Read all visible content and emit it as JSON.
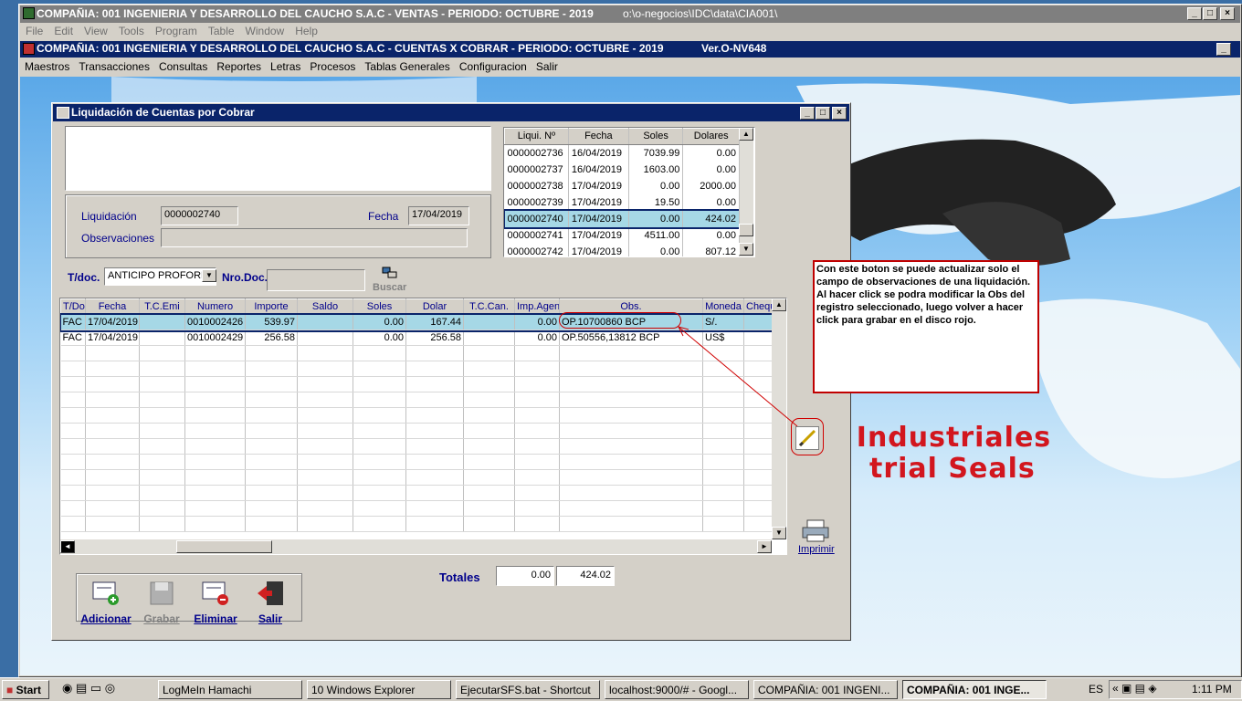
{
  "outer_window": {
    "title": "COMPAÑIA:  001 INGENIERIA Y DESARROLLO DEL CAUCHO S.A.C   -   VENTAS   -   PERIODO: OCTUBRE - 2019",
    "path": "o:\\o-negocios\\IDC\\data\\CIA001\\",
    "menu": [
      "File",
      "Edit",
      "View",
      "Tools",
      "Program",
      "Table",
      "Window",
      "Help"
    ]
  },
  "inner_window": {
    "title": "COMPAÑIA:  001 INGENIERIA Y DESARROLLO DEL CAUCHO S.A.C   -   CUENTAS X COBRAR   -   PERIODO: OCTUBRE - 2019",
    "version": "Ver.O-NV648",
    "menu": [
      "Maestros",
      "Transacciones",
      "Consultas",
      "Reportes",
      "Letras",
      "Procesos",
      "Tablas Generales",
      "Configuracion",
      "Salir"
    ]
  },
  "background_banner": {
    "line1": "e Industriales",
    "line2": "trial Seals"
  },
  "dialog": {
    "title": "Liquidación de Cuentas por Cobrar",
    "liquidacion_label": "Liquidación",
    "liquidacion_value": "0000002740",
    "fecha_label": "Fecha",
    "fecha_value": "17/04/2019",
    "observaciones_label": "Observaciones",
    "observaciones_value": "",
    "tdoc_label": "T/doc.",
    "tdoc_value": "ANTICIPO PROFORMA",
    "nrodoc_label": "Nro.Doc.",
    "nrodoc_value": "",
    "buscar_label": "Buscar",
    "liq_headers": [
      "Liqui. Nº",
      "Fecha",
      "Soles",
      "Dolares"
    ],
    "liq_rows": [
      [
        "0000002736",
        "16/04/2019",
        "7039.99",
        "0.00"
      ],
      [
        "0000002737",
        "16/04/2019",
        "1603.00",
        "0.00"
      ],
      [
        "0000002738",
        "17/04/2019",
        "0.00",
        "2000.00"
      ],
      [
        "0000002739",
        "17/04/2019",
        "19.50",
        "0.00"
      ],
      [
        "0000002740",
        "17/04/2019",
        "0.00",
        "424.02"
      ],
      [
        "0000002741",
        "17/04/2019",
        "4511.00",
        "0.00"
      ],
      [
        "0000002742",
        "17/04/2019",
        "0.00",
        "807.12"
      ]
    ],
    "liq_selected_index": 4,
    "grid_headers": [
      "T/Doc",
      "Fecha",
      "T.C.Emi",
      "Numero",
      "Importe",
      "Saldo",
      "Soles",
      "Dolar",
      "T.C.Can.",
      "Imp.Agent",
      "Obs.",
      "Moneda",
      "Chequ"
    ],
    "grid_rows": [
      [
        "FAC",
        "17/04/2019",
        "",
        "0010002426",
        "539.97",
        "",
        "0.00",
        "167.44",
        "",
        "0.00",
        "OP.10700860 BCP",
        "S/.",
        ""
      ],
      [
        "FAC",
        "17/04/2019",
        "",
        "0010002429",
        "256.58",
        "",
        "0.00",
        "256.58",
        "",
        "0.00",
        "OP.50556,13812 BCP",
        "US$",
        ""
      ]
    ],
    "totales_label": "Totales",
    "total_soles": "0.00",
    "total_dolares": "424.02",
    "imprimir_label": "Imprimir",
    "buttons": {
      "adicionar": "Adicionar",
      "grabar": "Grabar",
      "eliminar": "Eliminar",
      "salir": "Salir"
    }
  },
  "note": "Con este boton se puede actualizar solo el campo de observaciones de una liquidación.\nAl hacer click se podra modificar la Obs del registro seleccionado, luego volver a hacer click para grabar en el disco rojo.",
  "taskbar": {
    "start": "Start",
    "items": [
      "LogMeIn Hamachi",
      "10 Windows Explorer",
      "EjecutarSFS.bat - Shortcut",
      "localhost:9000/# - Googl...",
      "COMPAÑIA:  001 INGENI...",
      "COMPAÑIA:  001 INGE..."
    ],
    "lang": "ES",
    "time": "1:11 PM"
  },
  "colors": {
    "title_active": "#0a246a",
    "selection": "#a6d8e6",
    "label_blue": "#00008b",
    "note_border": "#c00000"
  }
}
